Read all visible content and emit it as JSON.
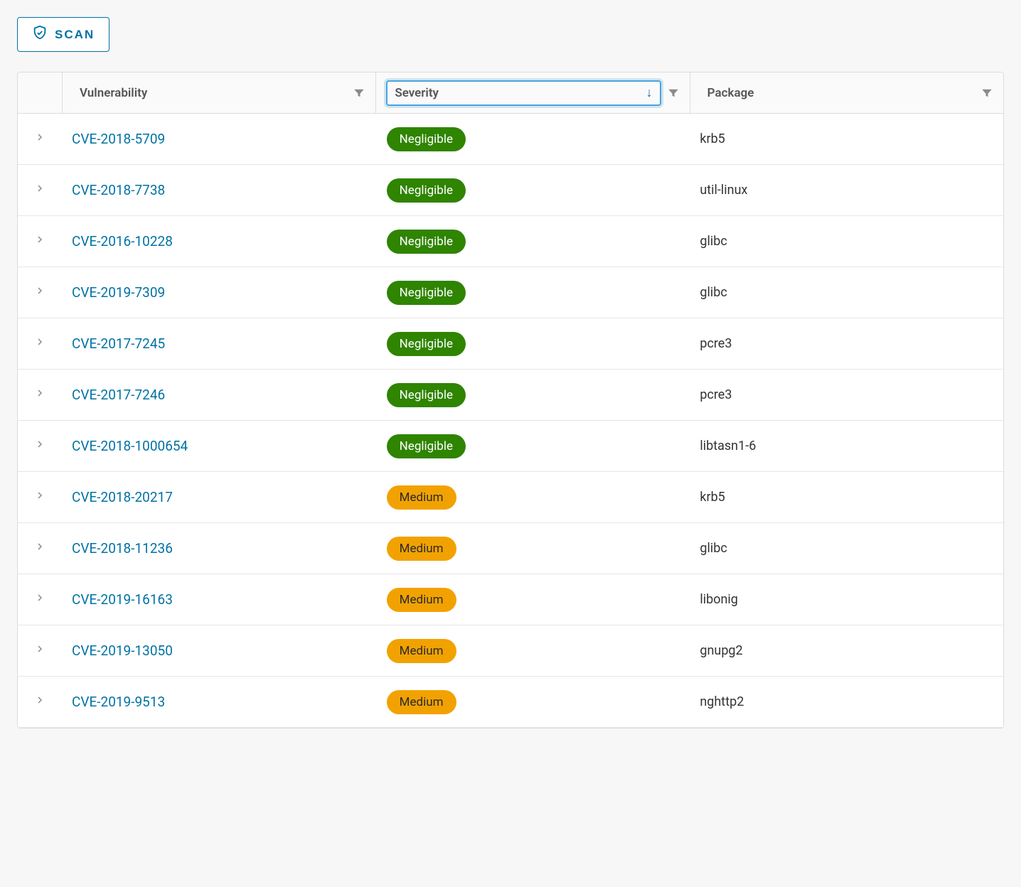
{
  "actions": {
    "scan_label": "SCAN"
  },
  "columns": {
    "vulnerability": "Vulnerability",
    "severity": "Severity",
    "package": "Package"
  },
  "sort": {
    "column": "severity",
    "direction": "asc"
  },
  "severity_colors": {
    "Negligible": "#2f8400",
    "Medium": "#f2a200"
  },
  "rows": [
    {
      "cve": "CVE-2018-5709",
      "severity": "Negligible",
      "package": "krb5"
    },
    {
      "cve": "CVE-2018-7738",
      "severity": "Negligible",
      "package": "util-linux"
    },
    {
      "cve": "CVE-2016-10228",
      "severity": "Negligible",
      "package": "glibc"
    },
    {
      "cve": "CVE-2019-7309",
      "severity": "Negligible",
      "package": "glibc"
    },
    {
      "cve": "CVE-2017-7245",
      "severity": "Negligible",
      "package": "pcre3"
    },
    {
      "cve": "CVE-2017-7246",
      "severity": "Negligible",
      "package": "pcre3"
    },
    {
      "cve": "CVE-2018-1000654",
      "severity": "Negligible",
      "package": "libtasn1-6"
    },
    {
      "cve": "CVE-2018-20217",
      "severity": "Medium",
      "package": "krb5"
    },
    {
      "cve": "CVE-2018-11236",
      "severity": "Medium",
      "package": "glibc"
    },
    {
      "cve": "CVE-2019-16163",
      "severity": "Medium",
      "package": "libonig"
    },
    {
      "cve": "CVE-2019-13050",
      "severity": "Medium",
      "package": "gnupg2"
    },
    {
      "cve": "CVE-2019-9513",
      "severity": "Medium",
      "package": "nghttp2"
    }
  ]
}
